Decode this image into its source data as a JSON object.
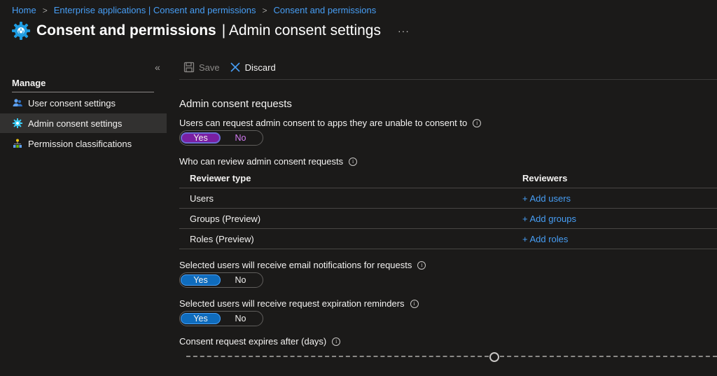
{
  "breadcrumb": {
    "items": [
      "Home",
      "Enterprise applications | Consent and permissions",
      "Consent and permissions"
    ]
  },
  "header": {
    "title": "Consent and permissions",
    "subtitle": "| Admin consent settings",
    "more": "···"
  },
  "sidebar": {
    "collapse": "«",
    "section": "Manage",
    "items": [
      {
        "label": "User consent settings",
        "icon": "users-icon"
      },
      {
        "label": "Admin consent settings",
        "icon": "gear-icon",
        "active": true
      },
      {
        "label": "Permission classifications",
        "icon": "hierarchy-icon"
      }
    ]
  },
  "toolbar": {
    "save_label": "Save",
    "discard_label": "Discard"
  },
  "main": {
    "section_title": "Admin consent requests",
    "request_label": "Users can request admin consent to apps they are unable to consent to",
    "request_toggle": {
      "yes": "Yes",
      "no": "No",
      "selected": "Yes"
    },
    "reviewers_label": "Who can review admin consent requests",
    "table": {
      "headers": [
        "Reviewer type",
        "Reviewers"
      ],
      "rows": [
        {
          "type": "Users",
          "action": "+ Add users"
        },
        {
          "type": "Groups (Preview)",
          "action": "+ Add groups"
        },
        {
          "type": "Roles (Preview)",
          "action": "+ Add roles"
        }
      ]
    },
    "email_label": "Selected users will receive email notifications for requests",
    "email_toggle": {
      "yes": "Yes",
      "no": "No",
      "selected": "Yes"
    },
    "reminder_label": "Selected users will receive request expiration reminders",
    "reminder_toggle": {
      "yes": "Yes",
      "no": "No",
      "selected": "Yes"
    },
    "expires_label": "Consent request expires after (days)",
    "expires_slider": {
      "fraction": 0.58
    }
  },
  "colors": {
    "background": "#1b1a19",
    "link": "#479ef5",
    "toggle_selected": "#0f6cbd",
    "toggle_selected_focus": "#7a1fa2"
  }
}
